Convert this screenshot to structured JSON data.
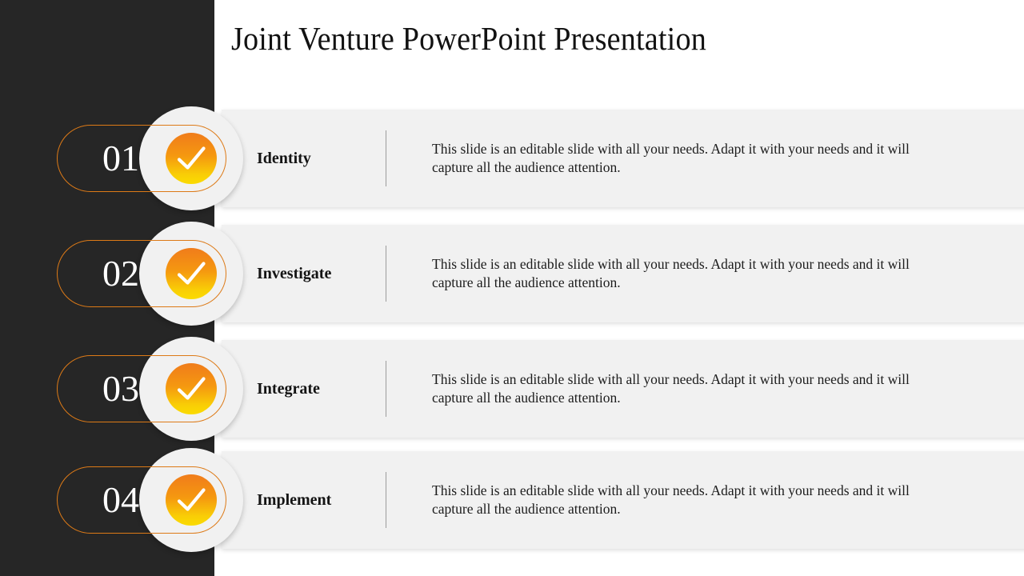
{
  "slide": {
    "title": "Joint Venture PowerPoint Presentation",
    "background_color": "#ffffff",
    "sidebar_color": "#262626",
    "panel_color": "#f1f1f1",
    "accent_color": "#dd7a17",
    "badge_gradient_from": "#f07c1b",
    "badge_gradient_to": "#fadb00",
    "divider_color": "#9b9b9b"
  },
  "steps": [
    {
      "number": "01",
      "label": "Identity",
      "icon": "check-icon",
      "description": "This slide is an editable slide with all your needs. Adapt it with your needs and it will capture all the audience attention."
    },
    {
      "number": "02",
      "label": "Investigate",
      "icon": "check-icon",
      "description": "This slide is an editable slide with all your needs. Adapt it with your needs and it will capture all the audience attention."
    },
    {
      "number": "03",
      "label": "Integrate",
      "icon": "check-icon",
      "description": "This slide is an editable slide with all your needs. Adapt it with your needs and it will capture all the audience attention."
    },
    {
      "number": "04",
      "label": "Implement",
      "icon": "check-icon",
      "description": "This slide is an editable slide with all your needs. Adapt it with your needs and it will capture all the audience attention."
    }
  ]
}
